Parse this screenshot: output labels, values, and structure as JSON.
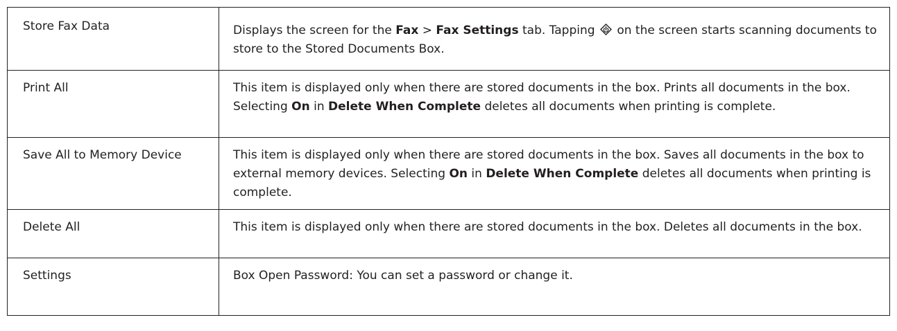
{
  "rows": [
    {
      "item": "Store Fax Data",
      "desc": {
        "t1": "Displays the screen for the ",
        "b1": "Fax",
        "t2": " > ",
        "b2": "Fax Settings",
        "t3": " tab. Tapping ",
        "icon": "start-button-icon",
        "t4": " on the screen starts scanning documents to store to the Stored Documents Box."
      }
    },
    {
      "item": "Print All",
      "desc": {
        "t1": "This item is displayed only when there are stored documents in the box. Prints all documents in the box. Selecting ",
        "b1": "On",
        "t2": " in ",
        "b2": "Delete When Complete",
        "t3": " deletes all documents when printing is complete."
      }
    },
    {
      "item": "Save All to Memory Device",
      "desc": {
        "t1": "This item is displayed only when there are stored documents in the box. Saves all documents in the box to external memory devices. Selecting ",
        "b1": "On",
        "t2": " in ",
        "b2": "Delete When Complete",
        "t3": " deletes all documents when printing is complete."
      }
    },
    {
      "item": "Delete All",
      "desc": {
        "t1": "This item is displayed only when there are stored documents in the box. Deletes all documents in the box."
      }
    },
    {
      "item": "Settings",
      "desc": {
        "t1": "Box Open Password: You can set a password or change it."
      }
    }
  ]
}
